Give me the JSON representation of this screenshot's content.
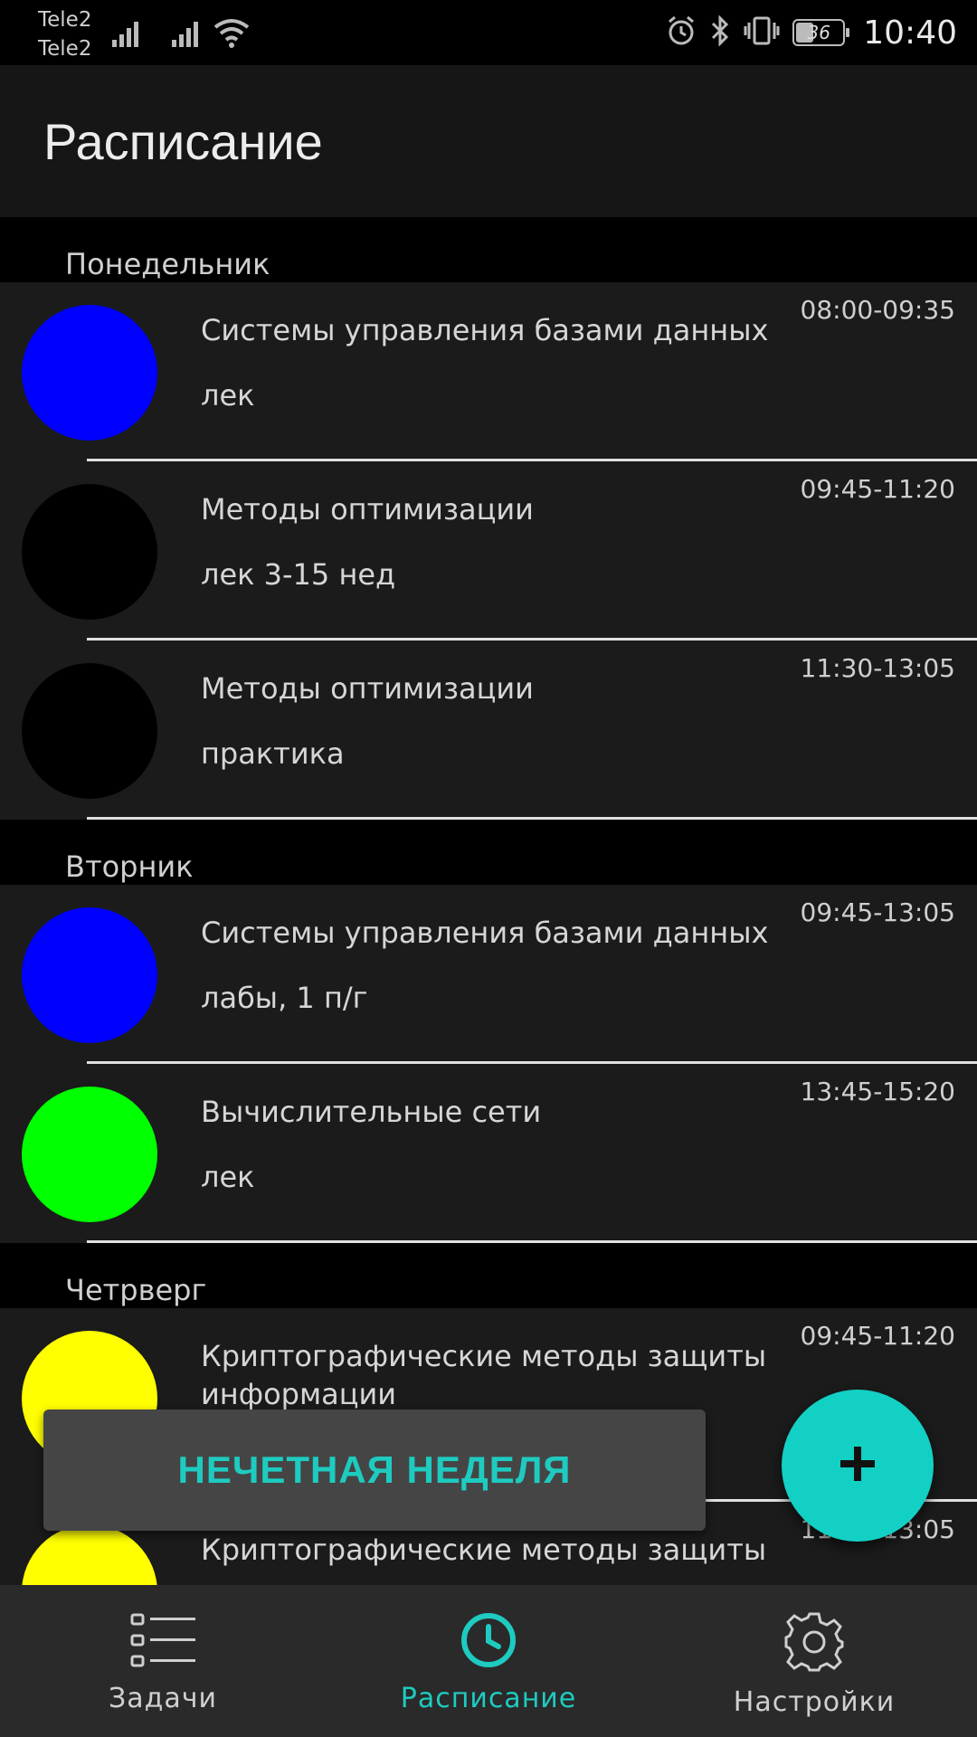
{
  "status_bar": {
    "carrier_1": "Tele2",
    "carrier_2": "Tele2",
    "battery": "36",
    "time": "10:40"
  },
  "app_bar": {
    "title": "Расписание"
  },
  "sections": [
    {
      "day": "Понедельник",
      "items": [
        {
          "title": "Системы управления базами данных",
          "subtitle": "лек",
          "time": "08:00-09:35",
          "color": "#0000ff"
        },
        {
          "title": "Методы оптимизации",
          "subtitle": "лек 3-15 нед",
          "time": "09:45-11:20",
          "color": "#000000"
        },
        {
          "title": "Методы оптимизации",
          "subtitle": "практика",
          "time": "11:30-13:05",
          "color": "#000000"
        }
      ]
    },
    {
      "day": "Вторник",
      "items": [
        {
          "title": "Системы управления базами данных",
          "subtitle": "лабы, 1 п/г",
          "time": "09:45-13:05",
          "color": "#0000ff"
        },
        {
          "title": "Вычислительные сети",
          "subtitle": "лек",
          "time": "13:45-15:20",
          "color": "#00ff00"
        }
      ]
    },
    {
      "day": "Четрверг",
      "items": [
        {
          "title": "Криптографические методы защиты информации",
          "subtitle": "",
          "time": "09:45-11:20",
          "color": "#ffff00"
        },
        {
          "title": "Криптографические методы защиты",
          "subtitle": "",
          "time": "11:30-13:05",
          "color": "#ffff00"
        }
      ]
    }
  ],
  "snackbar": {
    "text": "НЕЧЕТНАЯ НЕДЕЛЯ"
  },
  "fab": {
    "icon": "plus-icon"
  },
  "bottom_nav": {
    "tasks": {
      "label": "Задачи",
      "icon": "list-icon"
    },
    "schedule": {
      "label": "Расписание",
      "icon": "clock-icon"
    },
    "settings": {
      "label": "Настройки",
      "icon": "gear-icon"
    }
  },
  "colors": {
    "accent": "#1ecbc0",
    "fab": "#13d0c4",
    "background": "#000000",
    "row": "#1b1b1b"
  }
}
